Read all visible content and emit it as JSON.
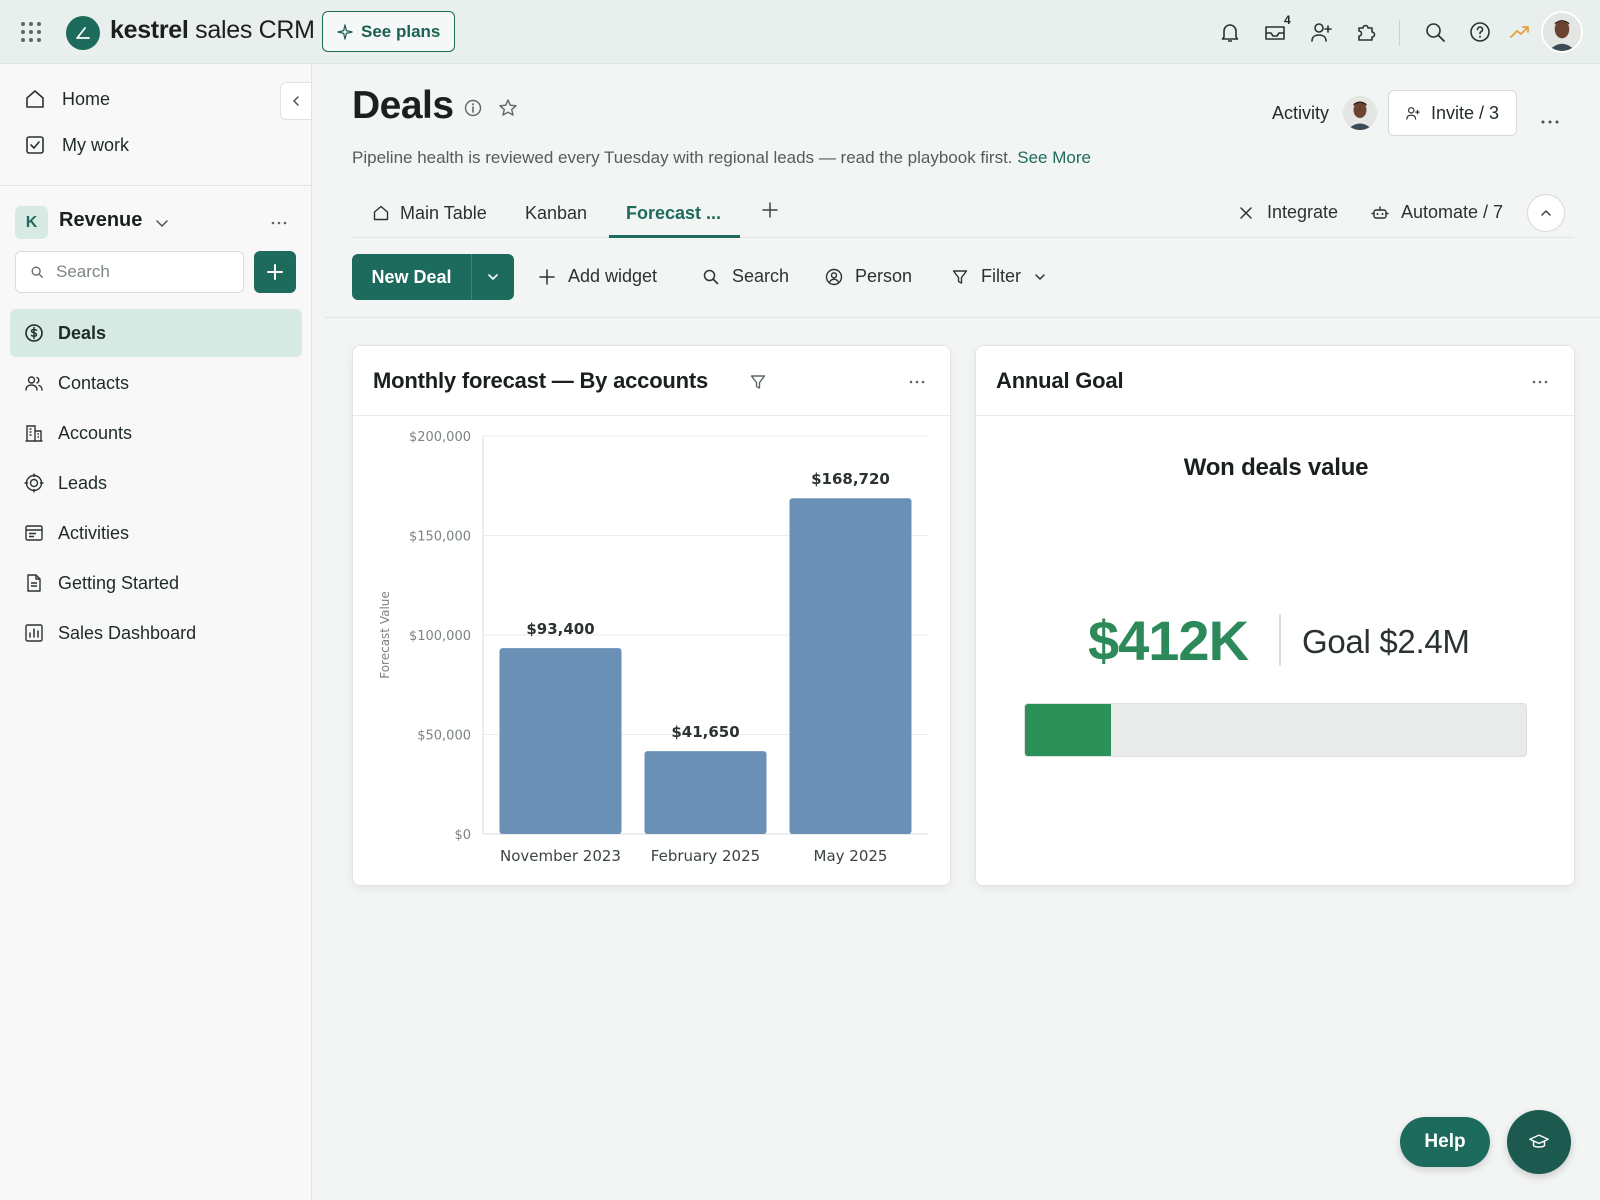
{
  "app": {
    "brand_bold": "kestrel",
    "brand_rest": " sales CRM",
    "see_plans_label": "See plans",
    "inbox_badge": "4",
    "accent_color": "#1d6b5c"
  },
  "topbar_icons": [
    "grid-icon",
    "bell-icon",
    "inbox-icon",
    "invite-person-icon",
    "puzzle-icon",
    "search-icon",
    "help-icon",
    "trending-icon"
  ],
  "sidebar": {
    "links": [
      {
        "label": "Home",
        "icon": "home-icon"
      },
      {
        "label": "My work",
        "icon": "checkbox-icon"
      }
    ],
    "workspace": {
      "badge": "K",
      "name": "Revenue"
    },
    "search_placeholder": "Search",
    "items": [
      {
        "label": "Deals",
        "icon": "dollar-icon",
        "active": true
      },
      {
        "label": "Contacts",
        "icon": "contacts-icon"
      },
      {
        "label": "Accounts",
        "icon": "building-icon"
      },
      {
        "label": "Leads",
        "icon": "target-icon"
      },
      {
        "label": "Activities",
        "icon": "calendar-list-icon"
      },
      {
        "label": "Getting Started",
        "icon": "document-icon"
      },
      {
        "label": "Sales Dashboard",
        "icon": "dashboard-icon"
      }
    ]
  },
  "header": {
    "title": "Deals",
    "activity_label": "Activity",
    "invite_label": "Invite / 3",
    "description": "Pipeline health is reviewed every Tuesday with regional leads — read the playbook first.",
    "see_more": "See More"
  },
  "tabs": [
    {
      "label": "Main Table",
      "icon": "home-icon"
    },
    {
      "label": "Kanban"
    },
    {
      "label": "Forecast ...",
      "active": true
    }
  ],
  "tab_actions": {
    "integrate_label": "Integrate",
    "automate_label": "Automate / 7"
  },
  "toolbar": {
    "new_deal_label": "New Deal",
    "add_widget_label": "Add widget",
    "search_label": "Search",
    "person_label": "Person",
    "filter_label": "Filter"
  },
  "forecast_widget": {
    "title": "Monthly forecast — By accounts"
  },
  "chart_data": {
    "type": "bar",
    "categories": [
      "November 2023",
      "February 2025",
      "May 2025"
    ],
    "values": [
      93400,
      41650,
      168720
    ],
    "value_labels": [
      "$93,400",
      "$41,650",
      "$168,720"
    ],
    "ylabel": "Forecast Value",
    "ylim": [
      0,
      200000
    ],
    "yticks": [
      0,
      50000,
      100000,
      150000,
      200000
    ],
    "ytick_labels": [
      "$0",
      "$50,000",
      "$100,000",
      "$150,000",
      "$200,000"
    ],
    "bar_color": "#6a90b5",
    "grid": true
  },
  "goal_widget": {
    "title": "Annual Goal",
    "heading": "Won deals value",
    "value": "$412K",
    "goal": "Goal $2.4M",
    "progress_fraction": 0.1717,
    "fill_color": "#2c9159"
  },
  "floating": {
    "help_label": "Help"
  }
}
